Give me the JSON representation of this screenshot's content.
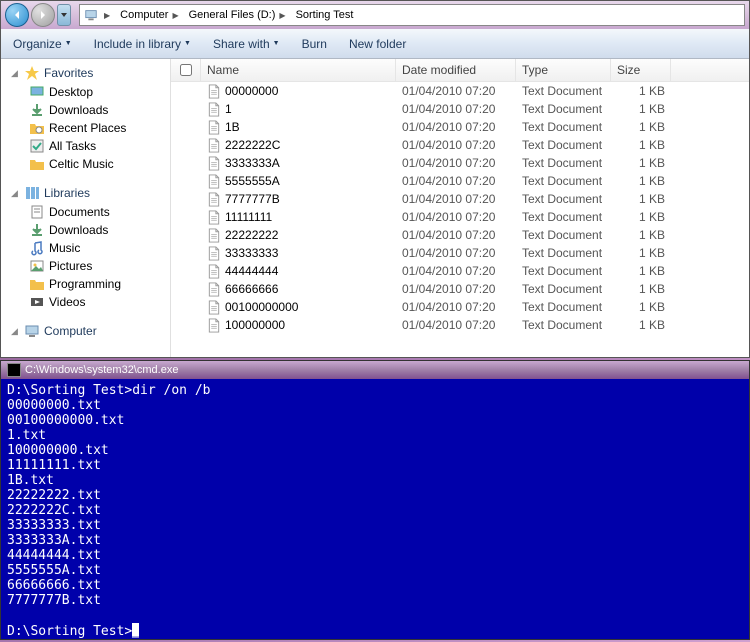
{
  "breadcrumb": {
    "root_icon": "computer",
    "segments": [
      "Computer",
      "General Files (D:)",
      "Sorting Test"
    ]
  },
  "toolbar": {
    "organize": "Organize",
    "include": "Include in library",
    "share": "Share with",
    "burn": "Burn",
    "newfolder": "New folder"
  },
  "sidebar": {
    "favorites": {
      "label": "Favorites",
      "items": [
        "Desktop",
        "Downloads",
        "Recent Places",
        "All Tasks",
        "Celtic Music"
      ]
    },
    "libraries": {
      "label": "Libraries",
      "items": [
        "Documents",
        "Downloads",
        "Music",
        "Pictures",
        "Programming",
        "Videos"
      ]
    },
    "computer": {
      "label": "Computer"
    }
  },
  "columns": {
    "name": "Name",
    "date": "Date modified",
    "type": "Type",
    "size": "Size"
  },
  "files": [
    {
      "name": "00000000",
      "date": "01/04/2010 07:20",
      "type": "Text Document",
      "size": "1 KB"
    },
    {
      "name": "1",
      "date": "01/04/2010 07:20",
      "type": "Text Document",
      "size": "1 KB"
    },
    {
      "name": "1B",
      "date": "01/04/2010 07:20",
      "type": "Text Document",
      "size": "1 KB"
    },
    {
      "name": "2222222C",
      "date": "01/04/2010 07:20",
      "type": "Text Document",
      "size": "1 KB"
    },
    {
      "name": "3333333A",
      "date": "01/04/2010 07:20",
      "type": "Text Document",
      "size": "1 KB"
    },
    {
      "name": "5555555A",
      "date": "01/04/2010 07:20",
      "type": "Text Document",
      "size": "1 KB"
    },
    {
      "name": "7777777B",
      "date": "01/04/2010 07:20",
      "type": "Text Document",
      "size": "1 KB"
    },
    {
      "name": "11111111",
      "date": "01/04/2010 07:20",
      "type": "Text Document",
      "size": "1 KB"
    },
    {
      "name": "22222222",
      "date": "01/04/2010 07:20",
      "type": "Text Document",
      "size": "1 KB"
    },
    {
      "name": "33333333",
      "date": "01/04/2010 07:20",
      "type": "Text Document",
      "size": "1 KB"
    },
    {
      "name": "44444444",
      "date": "01/04/2010 07:20",
      "type": "Text Document",
      "size": "1 KB"
    },
    {
      "name": "66666666",
      "date": "01/04/2010 07:20",
      "type": "Text Document",
      "size": "1 KB"
    },
    {
      "name": "00100000000",
      "date": "01/04/2010 07:20",
      "type": "Text Document",
      "size": "1 KB"
    },
    {
      "name": "100000000",
      "date": "01/04/2010 07:20",
      "type": "Text Document",
      "size": "1 KB"
    }
  ],
  "cmd": {
    "title": "C:\\Windows\\system32\\cmd.exe",
    "prompt1": "D:\\Sorting Test>",
    "command": "dir /on /b",
    "output": [
      "00000000.txt",
      "00100000000.txt",
      "1.txt",
      "100000000.txt",
      "11111111.txt",
      "1B.txt",
      "22222222.txt",
      "2222222C.txt",
      "33333333.txt",
      "3333333A.txt",
      "44444444.txt",
      "5555555A.txt",
      "66666666.txt",
      "7777777B.txt"
    ],
    "prompt2": "D:\\Sorting Test>"
  }
}
